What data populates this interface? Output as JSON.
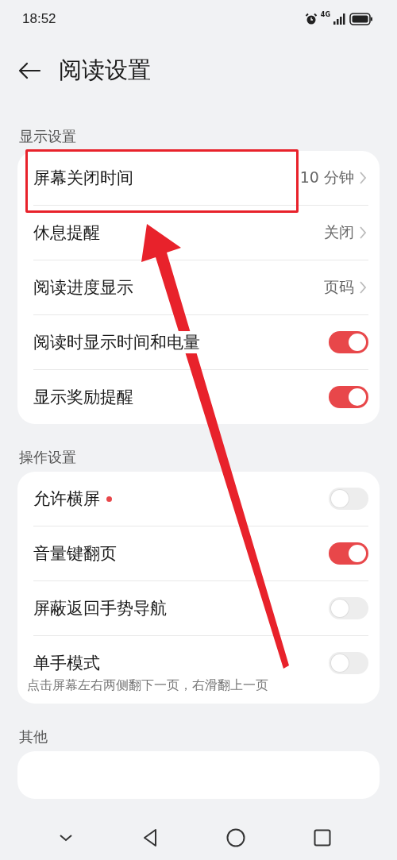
{
  "status_bar": {
    "time": "18:52",
    "network": "4G"
  },
  "header": {
    "title": "阅读设置"
  },
  "sections": [
    {
      "label": "显示设置",
      "rows": [
        {
          "kind": "link",
          "label": "屏幕关闭时间",
          "value": "10 分钟",
          "highlighted": true
        },
        {
          "kind": "link",
          "label": "休息提醒",
          "value": "关闭",
          "highlighted": false
        },
        {
          "kind": "link",
          "label": "阅读进度显示",
          "value": "页码",
          "highlighted": false
        },
        {
          "kind": "toggle",
          "label": "阅读时显示时间和电量",
          "on": true
        },
        {
          "kind": "toggle",
          "label": "显示奖励提醒",
          "on": true
        }
      ]
    },
    {
      "label": "操作设置",
      "rows": [
        {
          "kind": "toggle",
          "label": "允许横屏",
          "on": false,
          "badge": true
        },
        {
          "kind": "toggle",
          "label": "音量键翻页",
          "on": true
        },
        {
          "kind": "toggle",
          "label": "屏蔽返回手势导航",
          "on": false
        },
        {
          "kind": "toggle",
          "label": "单手模式",
          "on": false,
          "subtitle": "点击屏幕左右两侧翻下一页，右滑翻上一页"
        }
      ]
    },
    {
      "label": "其他"
    }
  ]
}
